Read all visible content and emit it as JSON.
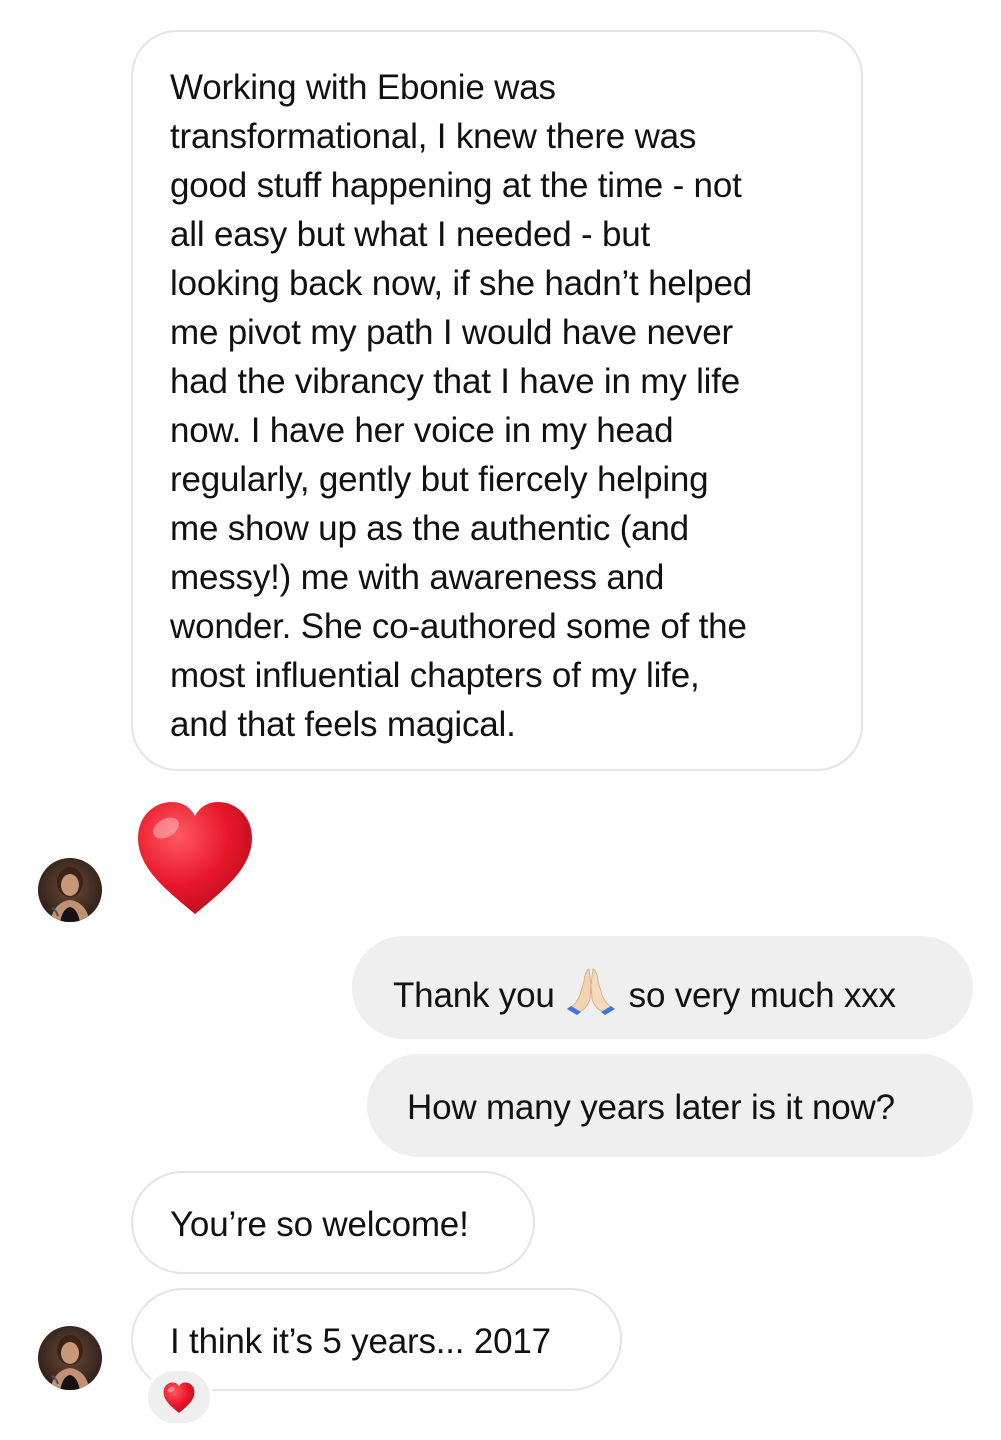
{
  "conversation": {
    "messages": [
      {
        "sender": "them",
        "text": "Working with Ebonie was\ntransformational, I knew there was\ngood stuff happening at the time - not\nall easy but what I needed - but\nlooking back now, if she hadn’t helped\nme pivot my path I would have never\nhad the vibrancy that I have in my life\nnow. I have her voice in my head\nregularly, gently but fiercely helping\nme show up as the authentic (and\nmessy!) me with awareness and\nwonder. She co-authored some of the\nmost influential chapters of my life,\nand that feels magical."
      },
      {
        "sender": "them",
        "emoji": "red-heart-icon"
      },
      {
        "sender": "me",
        "text_before_emoji": "Thank you",
        "emoji": "folded-hands-icon",
        "text_after_emoji": "so very much xxx"
      },
      {
        "sender": "me",
        "text": "How many years later is it now?"
      },
      {
        "sender": "them",
        "text": "You’re so welcome!"
      },
      {
        "sender": "them",
        "text": "I think it’s 5 years... 2017",
        "reaction": "red-heart-icon"
      }
    ]
  },
  "colors": {
    "incoming_bubble": "#ffffff",
    "incoming_border": "#e4e4e4",
    "outgoing_bubble": "#efefef",
    "heart_red": "#e8172b",
    "text": "#111111"
  }
}
